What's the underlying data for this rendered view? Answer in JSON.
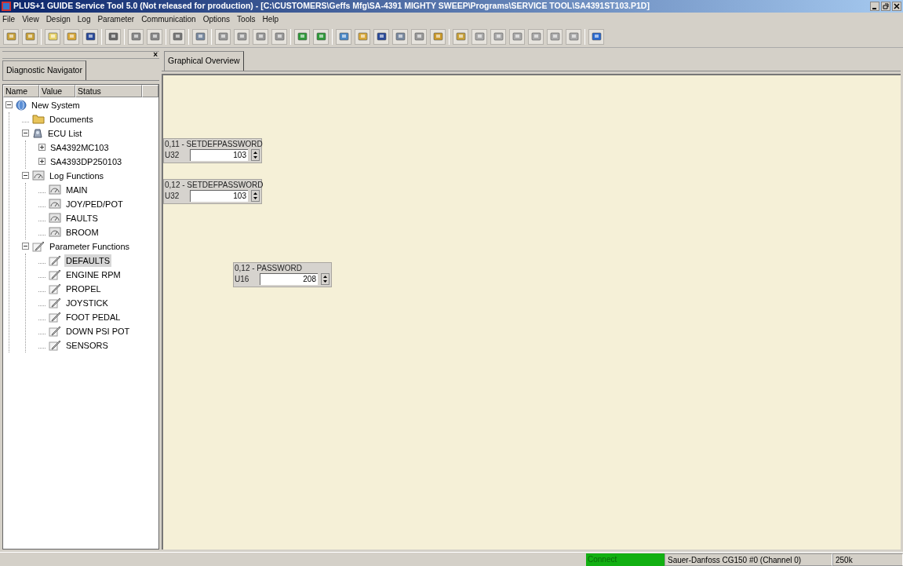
{
  "window": {
    "title": "PLUS+1 GUIDE Service Tool 5.0 (Not released for production) - [C:\\CUSTOMERS\\Geffs Mfg\\SA-4391 MIGHTY SWEEP\\Programs\\SERVICE TOOL\\SA4391ST103.P1D]"
  },
  "menu": [
    "File",
    "View",
    "Design",
    "Log",
    "Parameter",
    "Communication",
    "Options",
    "Tools",
    "Help"
  ],
  "navigator": {
    "tab": "Diagnostic Navigator",
    "close": "×",
    "columns": [
      "Name",
      "Value",
      "Status"
    ],
    "tree": [
      {
        "label": "New System",
        "kind": "globe",
        "expanded": true,
        "selected": false,
        "children": [
          {
            "label": "Documents",
            "kind": "folder",
            "selected": false
          },
          {
            "label": "ECU List",
            "kind": "ecu",
            "expanded": true,
            "selected": false,
            "children": [
              {
                "label": "SA4392MC103",
                "expanded": false,
                "selected": false
              },
              {
                "label": "SA4393DP250103",
                "expanded": false,
                "selected": false
              }
            ]
          },
          {
            "label": "Log Functions",
            "kind": "gauge",
            "expanded": true,
            "selected": false,
            "children": [
              {
                "label": "MAIN",
                "kind": "gauge",
                "selected": false
              },
              {
                "label": "JOY/PED/POT",
                "kind": "gauge",
                "selected": false
              },
              {
                "label": "FAULTS",
                "kind": "gauge",
                "selected": false
              },
              {
                "label": "BROOM",
                "kind": "gauge",
                "selected": false
              }
            ]
          },
          {
            "label": "Parameter Functions",
            "kind": "pencil",
            "expanded": true,
            "selected": false,
            "children": [
              {
                "label": "DEFAULTS",
                "kind": "pencil",
                "selected": true
              },
              {
                "label": "ENGINE RPM",
                "kind": "pencil",
                "selected": false
              },
              {
                "label": "PROPEL",
                "kind": "pencil",
                "selected": false
              },
              {
                "label": "JOYSTICK",
                "kind": "pencil",
                "selected": false
              },
              {
                "label": "FOOT PEDAL",
                "kind": "pencil",
                "selected": false
              },
              {
                "label": "DOWN PSI POT",
                "kind": "pencil",
                "selected": false
              },
              {
                "label": "SENSORS",
                "kind": "pencil",
                "selected": false
              }
            ]
          }
        ]
      }
    ]
  },
  "overview": {
    "tab": "Graphical Overview",
    "widgets": [
      {
        "title": "0,11 - SETDEFPASSWORD",
        "type": "U32",
        "value": "103"
      },
      {
        "title": "0,12 - SETDEFPASSWORD",
        "type": "U32",
        "value": "103"
      },
      {
        "title": "0,12 - PASSWORD",
        "type": "U16",
        "value": "208"
      }
    ]
  },
  "status_bar": {
    "connect": "Connect",
    "connected": true,
    "device": "Sauer-Danfoss CG150 #0 (Channel 0)",
    "rate": "250k"
  }
}
